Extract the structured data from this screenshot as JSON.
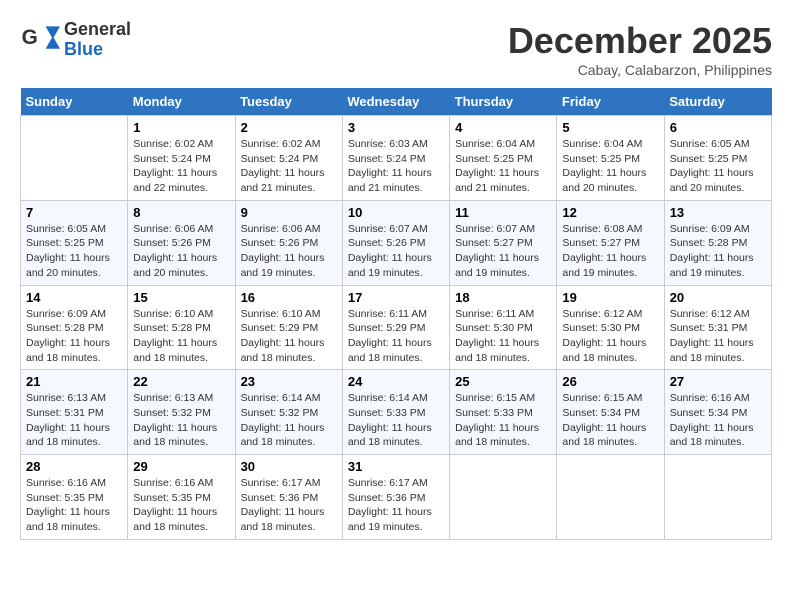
{
  "header": {
    "logo_general": "General",
    "logo_blue": "Blue",
    "month": "December 2025",
    "location": "Cabay, Calabarzon, Philippines"
  },
  "weekdays": [
    "Sunday",
    "Monday",
    "Tuesday",
    "Wednesday",
    "Thursday",
    "Friday",
    "Saturday"
  ],
  "weeks": [
    [
      {
        "day": "",
        "sunrise": "",
        "sunset": "",
        "daylight": ""
      },
      {
        "day": "1",
        "sunrise": "6:02 AM",
        "sunset": "5:24 PM",
        "daylight": "11 hours and 22 minutes."
      },
      {
        "day": "2",
        "sunrise": "6:02 AM",
        "sunset": "5:24 PM",
        "daylight": "11 hours and 21 minutes."
      },
      {
        "day": "3",
        "sunrise": "6:03 AM",
        "sunset": "5:24 PM",
        "daylight": "11 hours and 21 minutes."
      },
      {
        "day": "4",
        "sunrise": "6:04 AM",
        "sunset": "5:25 PM",
        "daylight": "11 hours and 21 minutes."
      },
      {
        "day": "5",
        "sunrise": "6:04 AM",
        "sunset": "5:25 PM",
        "daylight": "11 hours and 20 minutes."
      },
      {
        "day": "6",
        "sunrise": "6:05 AM",
        "sunset": "5:25 PM",
        "daylight": "11 hours and 20 minutes."
      }
    ],
    [
      {
        "day": "7",
        "sunrise": "6:05 AM",
        "sunset": "5:25 PM",
        "daylight": "11 hours and 20 minutes."
      },
      {
        "day": "8",
        "sunrise": "6:06 AM",
        "sunset": "5:26 PM",
        "daylight": "11 hours and 20 minutes."
      },
      {
        "day": "9",
        "sunrise": "6:06 AM",
        "sunset": "5:26 PM",
        "daylight": "11 hours and 19 minutes."
      },
      {
        "day": "10",
        "sunrise": "6:07 AM",
        "sunset": "5:26 PM",
        "daylight": "11 hours and 19 minutes."
      },
      {
        "day": "11",
        "sunrise": "6:07 AM",
        "sunset": "5:27 PM",
        "daylight": "11 hours and 19 minutes."
      },
      {
        "day": "12",
        "sunrise": "6:08 AM",
        "sunset": "5:27 PM",
        "daylight": "11 hours and 19 minutes."
      },
      {
        "day": "13",
        "sunrise": "6:09 AM",
        "sunset": "5:28 PM",
        "daylight": "11 hours and 19 minutes."
      }
    ],
    [
      {
        "day": "14",
        "sunrise": "6:09 AM",
        "sunset": "5:28 PM",
        "daylight": "11 hours and 18 minutes."
      },
      {
        "day": "15",
        "sunrise": "6:10 AM",
        "sunset": "5:28 PM",
        "daylight": "11 hours and 18 minutes."
      },
      {
        "day": "16",
        "sunrise": "6:10 AM",
        "sunset": "5:29 PM",
        "daylight": "11 hours and 18 minutes."
      },
      {
        "day": "17",
        "sunrise": "6:11 AM",
        "sunset": "5:29 PM",
        "daylight": "11 hours and 18 minutes."
      },
      {
        "day": "18",
        "sunrise": "6:11 AM",
        "sunset": "5:30 PM",
        "daylight": "11 hours and 18 minutes."
      },
      {
        "day": "19",
        "sunrise": "6:12 AM",
        "sunset": "5:30 PM",
        "daylight": "11 hours and 18 minutes."
      },
      {
        "day": "20",
        "sunrise": "6:12 AM",
        "sunset": "5:31 PM",
        "daylight": "11 hours and 18 minutes."
      }
    ],
    [
      {
        "day": "21",
        "sunrise": "6:13 AM",
        "sunset": "5:31 PM",
        "daylight": "11 hours and 18 minutes."
      },
      {
        "day": "22",
        "sunrise": "6:13 AM",
        "sunset": "5:32 PM",
        "daylight": "11 hours and 18 minutes."
      },
      {
        "day": "23",
        "sunrise": "6:14 AM",
        "sunset": "5:32 PM",
        "daylight": "11 hours and 18 minutes."
      },
      {
        "day": "24",
        "sunrise": "6:14 AM",
        "sunset": "5:33 PM",
        "daylight": "11 hours and 18 minutes."
      },
      {
        "day": "25",
        "sunrise": "6:15 AM",
        "sunset": "5:33 PM",
        "daylight": "11 hours and 18 minutes."
      },
      {
        "day": "26",
        "sunrise": "6:15 AM",
        "sunset": "5:34 PM",
        "daylight": "11 hours and 18 minutes."
      },
      {
        "day": "27",
        "sunrise": "6:16 AM",
        "sunset": "5:34 PM",
        "daylight": "11 hours and 18 minutes."
      }
    ],
    [
      {
        "day": "28",
        "sunrise": "6:16 AM",
        "sunset": "5:35 PM",
        "daylight": "11 hours and 18 minutes."
      },
      {
        "day": "29",
        "sunrise": "6:16 AM",
        "sunset": "5:35 PM",
        "daylight": "11 hours and 18 minutes."
      },
      {
        "day": "30",
        "sunrise": "6:17 AM",
        "sunset": "5:36 PM",
        "daylight": "11 hours and 18 minutes."
      },
      {
        "day": "31",
        "sunrise": "6:17 AM",
        "sunset": "5:36 PM",
        "daylight": "11 hours and 19 minutes."
      },
      {
        "day": "",
        "sunrise": "",
        "sunset": "",
        "daylight": ""
      },
      {
        "day": "",
        "sunrise": "",
        "sunset": "",
        "daylight": ""
      },
      {
        "day": "",
        "sunrise": "",
        "sunset": "",
        "daylight": ""
      }
    ]
  ]
}
